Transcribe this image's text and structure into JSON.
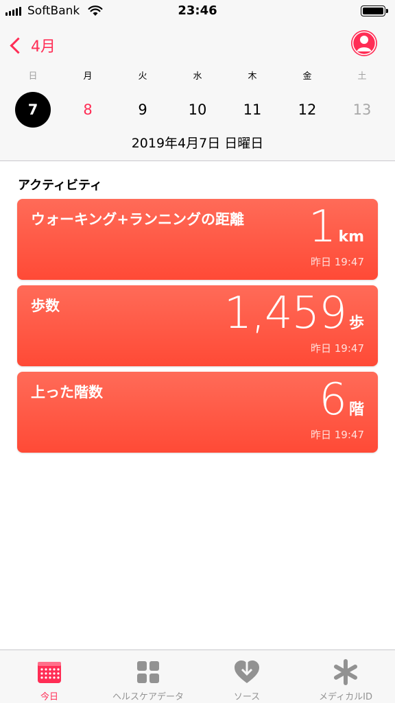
{
  "status_bar": {
    "carrier": "SoftBank",
    "time": "23:46"
  },
  "header": {
    "back_label": "4月",
    "profile_icon": "person-circle-icon"
  },
  "week": {
    "days": [
      {
        "weekday": "日",
        "date": "7",
        "state": "selected"
      },
      {
        "weekday": "月",
        "date": "8",
        "state": "today"
      },
      {
        "weekday": "火",
        "date": "9",
        "state": "normal"
      },
      {
        "weekday": "水",
        "date": "10",
        "state": "normal"
      },
      {
        "weekday": "木",
        "date": "11",
        "state": "normal"
      },
      {
        "weekday": "金",
        "date": "12",
        "state": "normal"
      },
      {
        "weekday": "土",
        "date": "13",
        "state": "future"
      }
    ],
    "selected_date": "2019年4月7日 日曜日"
  },
  "activity": {
    "title": "アクティビティ",
    "cards": [
      {
        "title": "ウォーキング+ランニングの距離",
        "value": "1",
        "unit": "km",
        "time": "昨日 19:47"
      },
      {
        "title": "歩数",
        "value": "1,459",
        "unit": "歩",
        "time": "昨日 19:47"
      },
      {
        "title": "上った階数",
        "value": "6",
        "unit": "階",
        "time": "昨日 19:47"
      }
    ]
  },
  "tab_bar": {
    "tabs": [
      {
        "label": "今日",
        "icon": "calendar-icon",
        "active": true
      },
      {
        "label": "ヘルスケアデータ",
        "icon": "grid-icon",
        "active": false
      },
      {
        "label": "ソース",
        "icon": "heart-download-icon",
        "active": false
      },
      {
        "label": "メディカルID",
        "icon": "asterisk-icon",
        "active": false
      }
    ]
  },
  "colors": {
    "accent": "#ff2d55",
    "card": "#ff5a45",
    "inactive_tab": "#929292"
  }
}
